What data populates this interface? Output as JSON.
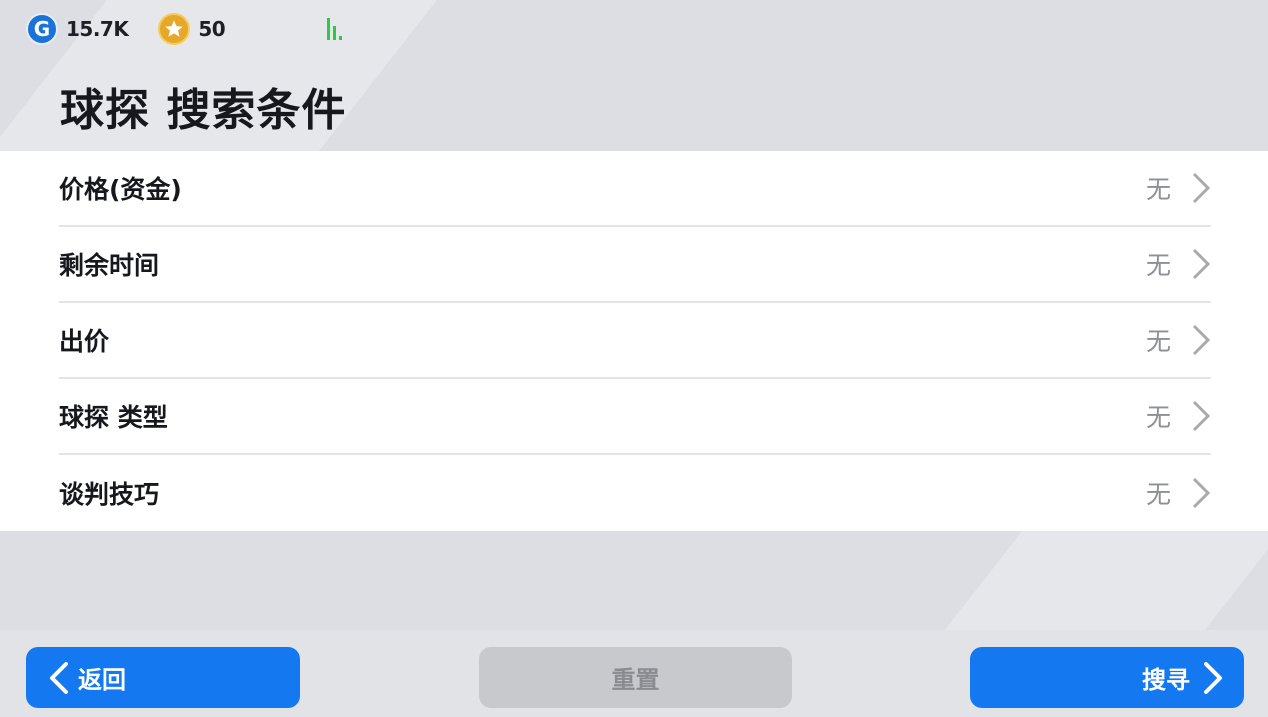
{
  "status": {
    "gold_icon": "G",
    "gold_value": "15.7K",
    "coin_icon": "star-coin-icon",
    "coin_value": "50",
    "signal_icon": "signal-bars-icon",
    "signal_color": "#2ec84a"
  },
  "page_title": "球探 搜索条件",
  "filters": [
    {
      "label": "价格(资金)",
      "value": "无"
    },
    {
      "label": "剩余时间",
      "value": "无"
    },
    {
      "label": "出价",
      "value": "无"
    },
    {
      "label": "球探 类型",
      "value": "无"
    },
    {
      "label": "谈判技巧",
      "value": "无"
    }
  ],
  "buttons": {
    "back_label": "返回",
    "reset_label": "重置",
    "search_label": "搜寻"
  },
  "colors": {
    "accent": "#1478f0",
    "disabled": "#c8c9cd",
    "background": "#dcdee4"
  }
}
